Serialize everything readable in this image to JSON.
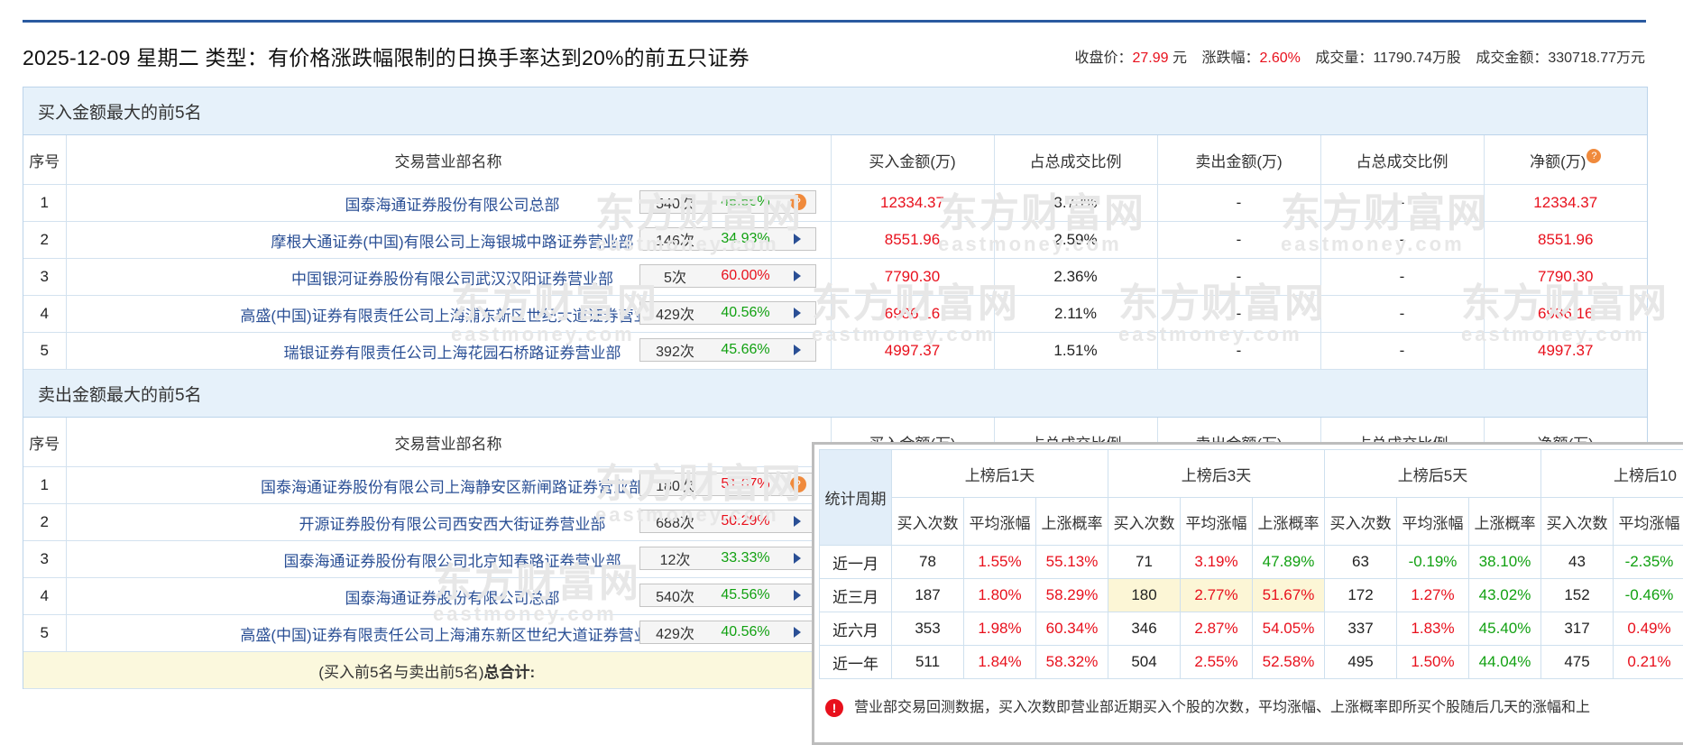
{
  "header": {
    "title": "2025-12-09 星期二 类型：有价格涨跌幅限制的日换手率达到20%的前五只证券",
    "close_label": "收盘价：",
    "close_value": "27.99",
    "close_unit": "元",
    "change_label": "涨跌幅：",
    "change_value": "2.60%",
    "volume_label": "成交量：",
    "volume_value": "11790.74万股",
    "amount_label": "成交金额：",
    "amount_value": "330718.77万元"
  },
  "buy_section": {
    "title": "买入金额最大的前5名",
    "columns": [
      "序号",
      "交易营业部名称",
      "买入金额(万)",
      "占总成交比例",
      "卖出金额(万)",
      "占总成交比例",
      "净额(万)"
    ],
    "rows": [
      {
        "no": "1",
        "name": "国泰海通证券股份有限公司总部",
        "count": "540次",
        "pct": "45.56%",
        "buy": "12334.37",
        "buy_ratio": "3.73%",
        "sell": "-",
        "sell_ratio": "-",
        "net": "12334.37"
      },
      {
        "no": "2",
        "name": "摩根大通证券(中国)有限公司上海银城中路证券营业部",
        "count": "146次",
        "pct": "34.93%",
        "buy": "8551.96",
        "buy_ratio": "2.59%",
        "sell": "-",
        "sell_ratio": "-",
        "net": "8551.96"
      },
      {
        "no": "3",
        "name": "中国银河证券股份有限公司武汉汉阳证券营业部",
        "count": "5次",
        "pct": "60.00%",
        "buy": "7790.30",
        "buy_ratio": "2.36%",
        "sell": "-",
        "sell_ratio": "-",
        "net": "7790.30"
      },
      {
        "no": "4",
        "name": "高盛(中国)证券有限责任公司上海浦东新区世纪大道证券营业部",
        "count": "429次",
        "pct": "40.56%",
        "buy": "6986.16",
        "buy_ratio": "2.11%",
        "sell": "-",
        "sell_ratio": "-",
        "net": "6986.16"
      },
      {
        "no": "5",
        "name": "瑞银证券有限责任公司上海花园石桥路证券营业部",
        "count": "392次",
        "pct": "45.66%",
        "buy": "4997.37",
        "buy_ratio": "1.51%",
        "sell": "-",
        "sell_ratio": "-",
        "net": "4997.37"
      }
    ]
  },
  "sell_section": {
    "title": "卖出金额最大的前5名",
    "columns": [
      "序号",
      "交易营业部名称",
      "买入金额(万)",
      "占总成交比例",
      "卖出金额(万)",
      "占总成交比例",
      "净额(万)"
    ],
    "rows": [
      {
        "no": "1",
        "name": "国泰海通证券股份有限公司上海静安区新闸路证券营业部",
        "count": "180次",
        "pct": "51.67%"
      },
      {
        "no": "2",
        "name": "开源证券股份有限公司西安西大街证券营业部",
        "count": "688次",
        "pct": "50.29%"
      },
      {
        "no": "3",
        "name": "国泰海通证券股份有限公司北京知春路证券营业部",
        "count": "12次",
        "pct": "33.33%"
      },
      {
        "no": "4",
        "name": "国泰海通证券股份有限公司总部",
        "count": "540次",
        "pct": "45.56%"
      },
      {
        "no": "5",
        "name": "高盛(中国)证券有限责任公司上海浦东新区世纪大道证券营业部",
        "count": "429次",
        "pct": "40.56%"
      }
    ],
    "total_prefix": "(买入前5名与卖出前5名)",
    "total_label": "总合计:"
  },
  "popup": {
    "period_label": "统计周期",
    "groups": [
      "上榜后1天",
      "上榜后3天",
      "上榜后5天",
      "上榜后10"
    ],
    "subheaders": [
      "买入次数",
      "平均涨幅",
      "上涨概率",
      "买入次数",
      "平均涨幅",
      "上涨概率",
      "买入次数",
      "平均涨幅",
      "上涨概率",
      "买入次数",
      "平均涨幅"
    ],
    "rows": [
      {
        "period": "近一月",
        "cells": [
          "78",
          "1.55%",
          "55.13%",
          "71",
          "3.19%",
          "47.89%",
          "63",
          "-0.19%",
          "38.10%",
          "43",
          "-2.35%"
        ]
      },
      {
        "period": "近三月",
        "cells": [
          "187",
          "1.80%",
          "58.29%",
          "180",
          "2.77%",
          "51.67%",
          "172",
          "1.27%",
          "43.02%",
          "152",
          "-0.46%"
        ]
      },
      {
        "period": "近六月",
        "cells": [
          "353",
          "1.98%",
          "60.34%",
          "346",
          "2.87%",
          "54.05%",
          "337",
          "1.83%",
          "45.40%",
          "317",
          "0.49%"
        ]
      },
      {
        "period": "近一年",
        "cells": [
          "511",
          "1.84%",
          "58.32%",
          "504",
          "2.55%",
          "52.58%",
          "495",
          "1.50%",
          "44.04%",
          "475",
          "0.21%"
        ]
      }
    ],
    "note": "营业部交易回测数据，买入次数即营业部近期买入个股的次数，平均涨幅、上涨概率即所买个股随后几天的涨幅和上"
  },
  "watermark": {
    "brand": "东方财富网",
    "domain": "eastmoney.com"
  },
  "colors": {
    "up": "#e8101c",
    "down": "#12a112",
    "header_bg": "#e6f1fa",
    "link": "#2a4f95",
    "accent_line": "#2a5aa0",
    "total_bg": "#fbf8dd"
  }
}
